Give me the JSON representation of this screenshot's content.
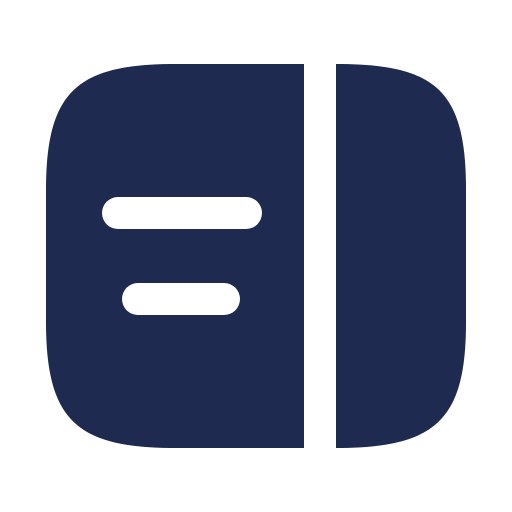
{
  "icon": {
    "name": "sidebar-right-text-icon",
    "color": "#1E2A4F",
    "background": "#FFFFFF",
    "line_color": "#FFFFFF"
  }
}
